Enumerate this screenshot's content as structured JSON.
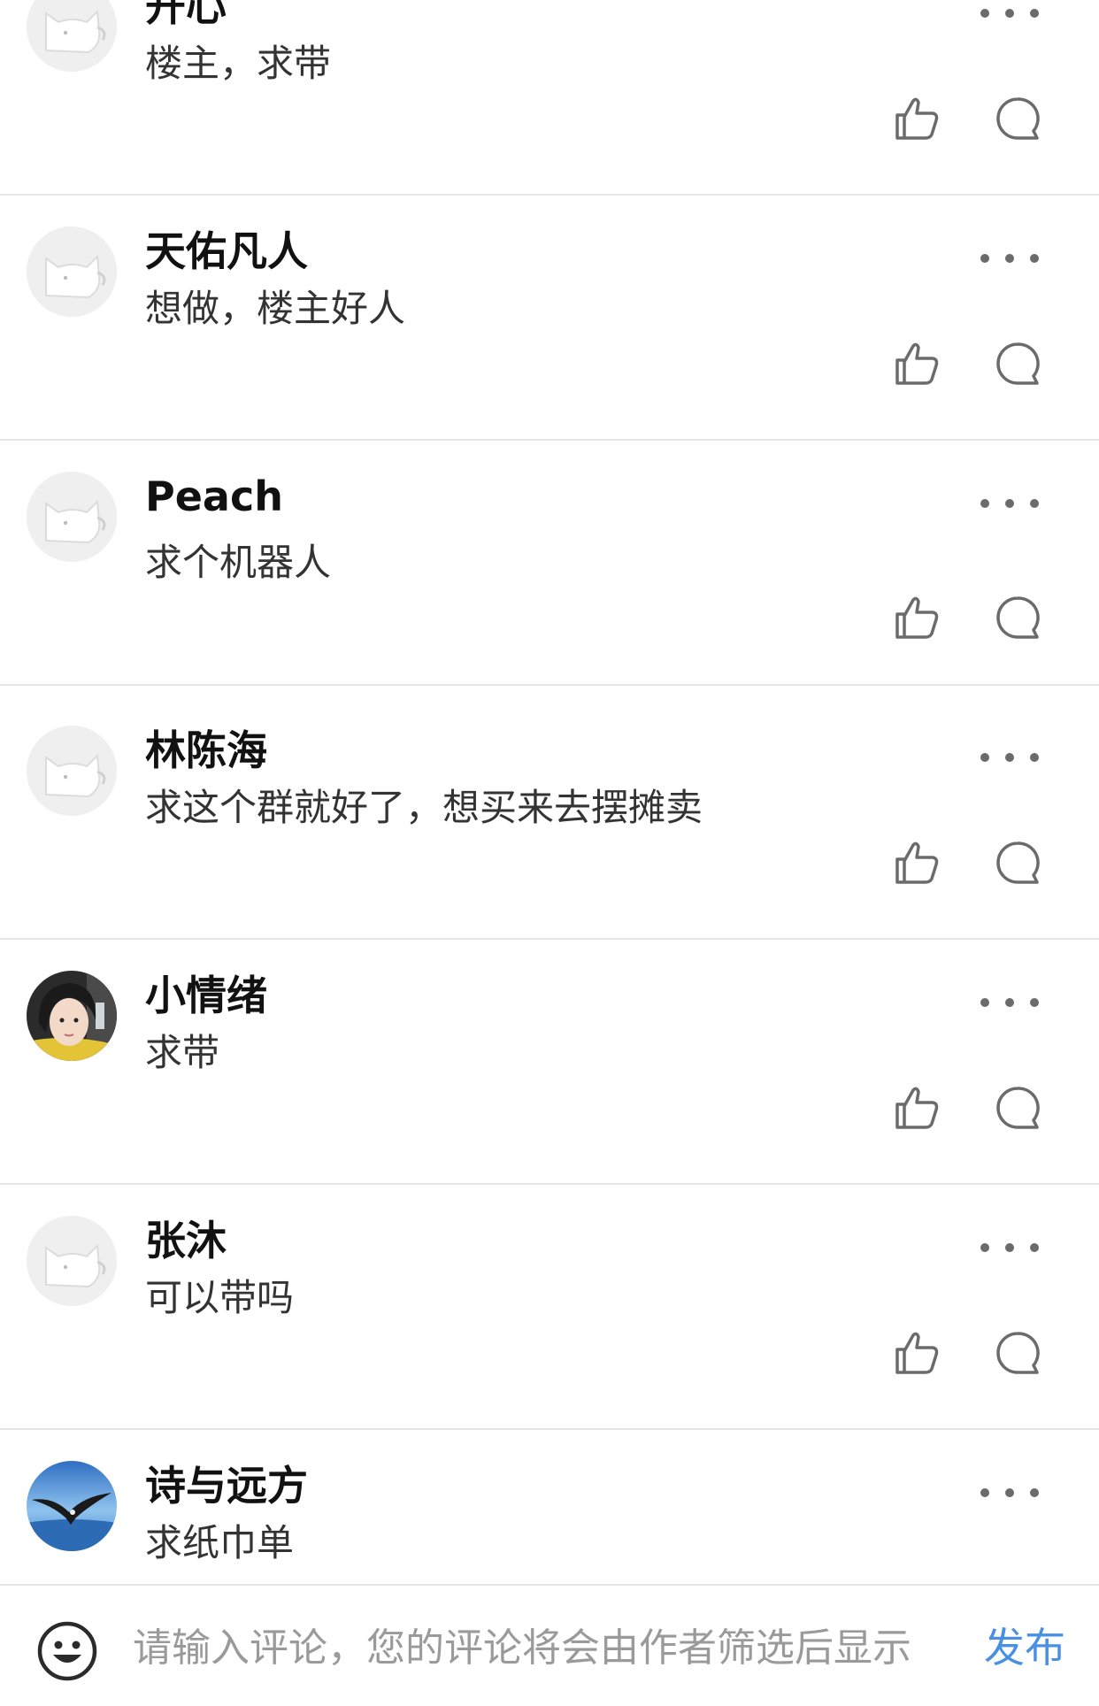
{
  "comments": [
    {
      "username": "开心",
      "content": "楼主，求带",
      "avatar": "dog-avatar"
    },
    {
      "username": "天佑凡人",
      "content": "想做，楼主好人",
      "avatar": "dog-avatar"
    },
    {
      "username": "Peach",
      "content": "求个机器人",
      "avatar": "dog-avatar"
    },
    {
      "username": "林陈海",
      "content": "求这个群就好了，想买来去摆摊卖",
      "avatar": "dog-avatar"
    },
    {
      "username": "小情绪",
      "content": "求带",
      "avatar": "girl-photo-avatar"
    },
    {
      "username": "张沐",
      "content": "可以带吗",
      "avatar": "dog-avatar"
    },
    {
      "username": "诗与远方",
      "content": "求纸巾单",
      "avatar": "eagle-photo-avatar"
    }
  ],
  "icons": {
    "more": "more-dots-icon",
    "like": "thumbs-up-icon",
    "reply": "comment-bubble-icon",
    "emoji": "smiley-face-icon"
  },
  "input_bar": {
    "placeholder": "请输入评论，您的评论将会由作者筛选后显示",
    "publish_label": "发布"
  },
  "colors": {
    "accent": "#4a90e2",
    "divider": "#e6e6e6",
    "icon_gray": "#6b6b6b",
    "placeholder": "#9a9a9a"
  }
}
